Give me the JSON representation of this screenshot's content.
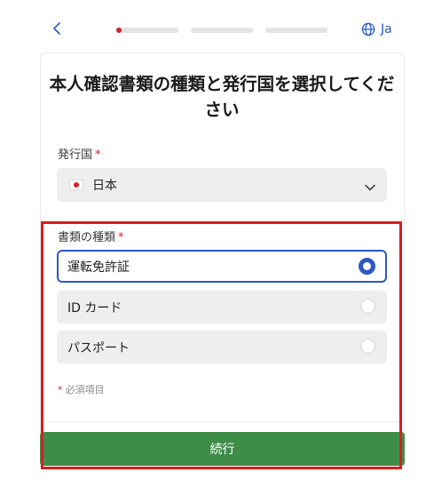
{
  "header": {
    "back_icon": "chevron-left-icon",
    "progress_steps": 3,
    "current_step": 1,
    "language_icon": "globe-icon",
    "language_label": "Ja"
  },
  "title": "本人確認書類の種類と発行国を選択してください",
  "country": {
    "label": "発行国",
    "required_mark": "*",
    "selected_value": "日本",
    "flag_icon": "japan-flag-icon"
  },
  "document_type": {
    "label": "書類の種類",
    "required_mark": "*",
    "options": [
      {
        "label": "運転免許証",
        "selected": true
      },
      {
        "label": "ID カード",
        "selected": false
      },
      {
        "label": "パスポート",
        "selected": false
      }
    ]
  },
  "required_note": {
    "mark": "*",
    "text": "必須項目"
  },
  "continue_label": "続行",
  "colors": {
    "accent": "#2b59c3",
    "primary_button": "#3d8d48",
    "required": "#d02323",
    "highlight_box": "#d81f1f"
  }
}
